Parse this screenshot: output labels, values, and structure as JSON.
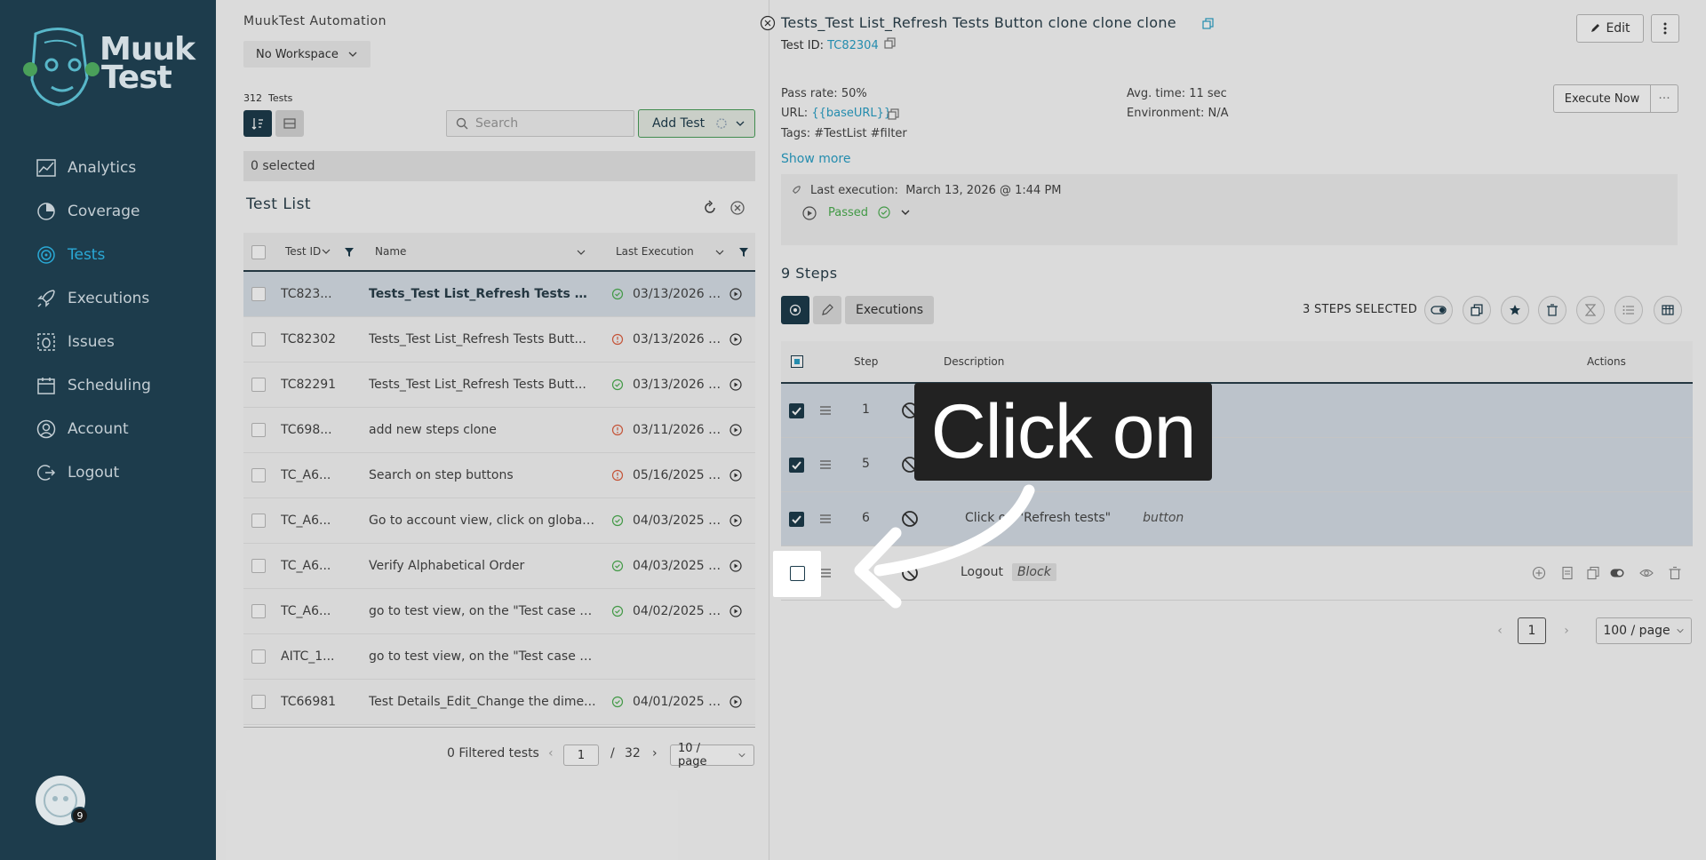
{
  "sidebar": {
    "logo_text_line1": "Muuk",
    "logo_text_line2": "Test",
    "items": [
      {
        "label": "Analytics",
        "icon": "analytics-icon"
      },
      {
        "label": "Coverage",
        "icon": "coverage-icon"
      },
      {
        "label": "Tests",
        "icon": "tests-icon",
        "active": true
      },
      {
        "label": "Executions",
        "icon": "rocket-icon"
      },
      {
        "label": "Issues",
        "icon": "bug-icon"
      },
      {
        "label": "Scheduling",
        "icon": "calendar-icon"
      },
      {
        "label": "Account",
        "icon": "user-icon"
      },
      {
        "label": "Logout",
        "icon": "logout-icon"
      }
    ],
    "avatar_badge": "9"
  },
  "middle": {
    "app_title": "MuukTest Automation",
    "workspace": "No Workspace",
    "test_count_num": "312",
    "test_count_label": "Tests",
    "search_placeholder": "Search",
    "add_test_label": "Add Test",
    "selected_text": "0 selected",
    "list_title": "Test List",
    "columns": {
      "test_id": "Test ID",
      "name": "Name",
      "last_execution": "Last Execution"
    },
    "rows": [
      {
        "id": "TC823...",
        "name": "Tests_Test List_Refresh Tests B...",
        "date": "03/13/2026 1:...",
        "status": "passed",
        "selected": true
      },
      {
        "id": "TC82302",
        "name": "Tests_Test List_Refresh Tests Butt...",
        "date": "03/13/2026 2:...",
        "status": "warning"
      },
      {
        "id": "TC82291",
        "name": "Tests_Test List_Refresh Tests Butt...",
        "date": "03/13/2026 2:...",
        "status": "passed"
      },
      {
        "id": "TC698...",
        "name": "add new steps clone",
        "date": "03/11/2026 4:1...",
        "status": "warning"
      },
      {
        "id": "TC_A6...",
        "name": "Search on step buttons",
        "date": "05/16/2025 7:...",
        "status": "warning"
      },
      {
        "id": "TC_A6...",
        "name": "Go to account view, click on global v...",
        "date": "04/03/2025 6:...",
        "status": "passed"
      },
      {
        "id": "TC_A6...",
        "name": "Verify Alphabetical Order",
        "date": "04/03/2025 3:...",
        "status": "passed"
      },
      {
        "id": "TC_A6...",
        "name": "go to test view, on the \"Test case to ...",
        "date": "04/02/2025 4:...",
        "status": "passed"
      },
      {
        "id": "AITC_1...",
        "name": "go to test view, on the \"Test case to ...",
        "date": "",
        "status": "none"
      },
      {
        "id": "TC66981",
        "name": "Test Details_Edit_Change the dime...",
        "date": "04/01/2025 12...",
        "status": "passed"
      }
    ],
    "pager": {
      "filtered": "0 Filtered tests",
      "page": "1",
      "slash": "/",
      "total": "32",
      "per_page": "10 / page"
    }
  },
  "detail": {
    "title": "Tests_Test List_Refresh Tests Button clone clone clone",
    "test_id_label": "Test ID:",
    "test_id": "TC82304",
    "edit_label": "Edit",
    "pass_rate": "Pass rate: 50%",
    "url_label": "URL:",
    "url_value": "{{baseURL}}",
    "tags": "Tags: #TestList #filter",
    "show_more": "Show more",
    "avg_time": "Avg. time: 11 sec",
    "environment": "Environment: N/A",
    "execute_now": "Execute Now",
    "last_execution_label": "Last execution:",
    "last_execution_value": "March 13, 2026 @ 1:44 PM",
    "last_status": "Passed",
    "steps_title": "9 Steps",
    "executions_tab": "Executions",
    "steps_selected": "3 STEPS SELECTED",
    "step_columns": {
      "step": "Step",
      "description": "Description",
      "actions": "Actions"
    },
    "steps": [
      {
        "num": "1",
        "text": "",
        "tag": "",
        "checked": true
      },
      {
        "num": "5",
        "text": "",
        "tag": "",
        "checked": true
      },
      {
        "num": "6",
        "text": "Click on \"Refresh tests\"",
        "tag": "button",
        "checked": true
      },
      {
        "num": "",
        "text": "Logout",
        "tag": "Block",
        "checked": false
      }
    ],
    "step_page": "1",
    "step_per_page": "100 / page"
  },
  "overlay": {
    "callout_text": "Click on"
  },
  "colors": {
    "sidebar_bg": "#1d3c4c",
    "active_nav": "#2aa9d6",
    "link": "#2aa0c6",
    "passed": "#4caf50",
    "warning": "#e06040"
  }
}
